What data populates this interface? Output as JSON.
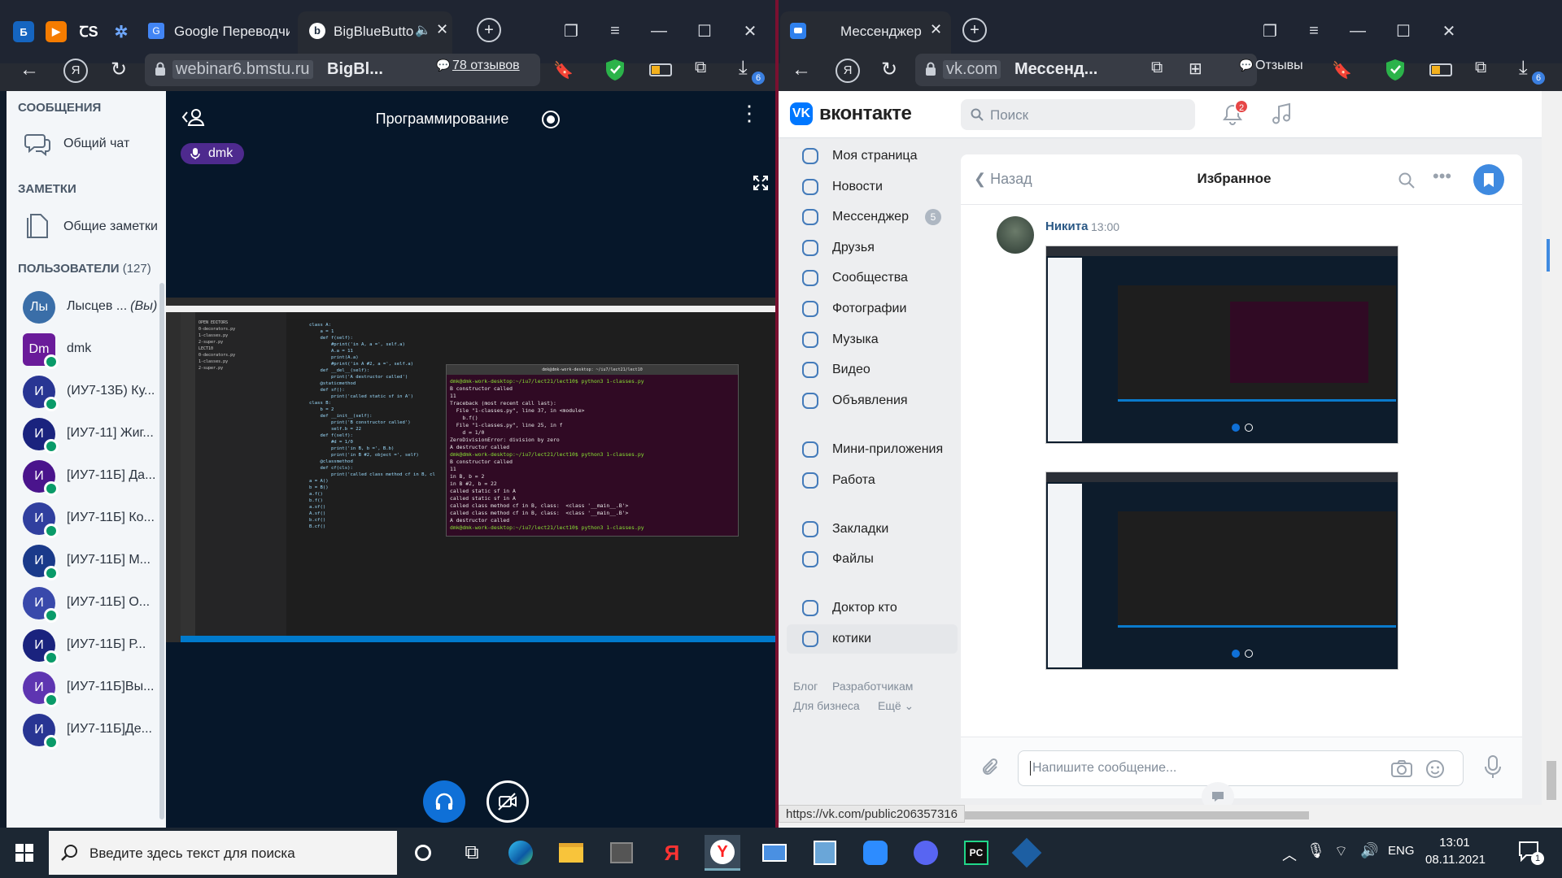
{
  "left_browser": {
    "tabs": [
      {
        "label": "Google Переводчи"
      },
      {
        "label": "BigBlueButton"
      }
    ],
    "address": {
      "domain": "webinar6.bmstu.ru",
      "title": "BigBl..."
    },
    "reviews": "78 отзывов",
    "downloads_badge": "6"
  },
  "bbb": {
    "sections": {
      "messages": "СООБЩЕНИЯ",
      "notes": "ЗАМЕТКИ",
      "users": "ПОЛЬЗОВАТЕЛИ",
      "users_count": "(127)"
    },
    "public_chat": "Общий чат",
    "shared_notes": "Общие заметки",
    "users": [
      {
        "initials": "Лы",
        "name": "Лысцев ...",
        "suffix": "(Вы)",
        "color": "#3a6ea8"
      },
      {
        "initials": "Dm",
        "name": "dmk",
        "color": "#6a1b9a"
      },
      {
        "initials": "И",
        "name": "(ИУ7-13Б) Ку...",
        "color": "#283593"
      },
      {
        "initials": "И",
        "name": "[ИУ7-11] Жиг...",
        "color": "#1a237e"
      },
      {
        "initials": "И",
        "name": "[ИУ7-11Б] Да...",
        "color": "#4a148c"
      },
      {
        "initials": "И",
        "name": "[ИУ7-11Б] Ко...",
        "color": "#303f9f"
      },
      {
        "initials": "И",
        "name": "[ИУ7-11Б] М...",
        "color": "#1a3a8a"
      },
      {
        "initials": "И",
        "name": "[ИУ7-11Б] О...",
        "color": "#3949ab"
      },
      {
        "initials": "И",
        "name": "[ИУ7-11Б] Р...",
        "color": "#1a237e"
      },
      {
        "initials": "И",
        "name": "[ИУ7-11Б]Вы...",
        "color": "#5e35b1"
      },
      {
        "initials": "И",
        "name": "[ИУ7-11Б]Де...",
        "color": "#283593"
      }
    ],
    "meeting_title": "Программирование",
    "presenter": "dmk",
    "terminal": {
      "title": "dmk@dmk-work-desktop: ~/iu7/lect21/lect10",
      "lines": [
        "dmk@dmk-work-desktop:~/iu7/lect21/lect10$ python3 1-classes.py",
        "B constructor called",
        "11",
        "Traceback (most recent call last):",
        "  File \"1-classes.py\", line 37, in <module>",
        "    b.f()",
        "  File \"1-classes.py\", line 25, in f",
        "    d = 1/0",
        "ZeroDivisionError: division by zero",
        "A destructor called",
        "dmk@dmk-work-desktop:~/iu7/lect21/lect10$ python3 1-classes.py",
        "B constructor called",
        "11",
        "in B, b = 2",
        "in B #2, b = 22",
        "called static sf in A",
        "called static sf in A",
        "called class method cf in B, class:  <class '__main__.B'>",
        "called class method cf in B, class:  <class '__main__.B'>",
        "A destructor called",
        "dmk@dmk-work-desktop:~/iu7/lect21/lect10$ python3 1-classes.py"
      ]
    },
    "code_lines": [
      "class A:",
      "    a = 1",
      "",
      "    def f(self):",
      "        #print('in A, a =', self.a)",
      "        A.a = 11",
      "        print(A.a)",
      "        #print('in A #2, a =', self.a)",
      "",
      "    def __del__(self):",
      "        print('A destructor called')",
      "",
      "    @staticmethod",
      "    def sf():",
      "        print('called static sf in A')",
      "",
      "class B:",
      "    b = 2",
      "",
      "    def __init__(self):",
      "        print('B constructor called')",
      "        self.b = 22",
      "",
      "    def f(self):",
      "        #d = 1/0",
      "        print('in B, b =', B.b)",
      "        print('in B #2, object =', self)",
      "",
      "    @classmethod",
      "    def cf(cls):",
      "        print('called class method cf in B, cl",
      "",
      "a = A()",
      "b = B()",
      "",
      "a.f()",
      "b.f()",
      "",
      "a.sf()",
      "A.sf()",
      "",
      "b.cf()",
      "B.cf()"
    ],
    "explorer": [
      "OPEN EDITORS",
      "0-decorators.py",
      "1-classes.py",
      "2-super.py",
      "LECT10",
      "0-decorators.py",
      "1-classes.py",
      "2-super.py"
    ]
  },
  "right_browser": {
    "tab": "Мессенджер",
    "address": {
      "domain": "vk.com",
      "title": "Мессенд..."
    },
    "reviews": "Отзывы",
    "downloads_badge": "6",
    "status_url": "https://vk.com/public206357316"
  },
  "vk": {
    "logo": "вконтакте",
    "search_placeholder": "Поиск",
    "notif_badge": "2",
    "menu": [
      {
        "label": "Моя страница",
        "icon": "user-circle-icon"
      },
      {
        "label": "Новости",
        "icon": "news-icon"
      },
      {
        "label": "Мессенджер",
        "icon": "message-icon",
        "badge": "5"
      },
      {
        "label": "Друзья",
        "icon": "friends-icon"
      },
      {
        "label": "Сообщества",
        "icon": "communities-icon"
      },
      {
        "label": "Фотографии",
        "icon": "photo-icon"
      },
      {
        "label": "Музыка",
        "icon": "music-icon"
      },
      {
        "label": "Видео",
        "icon": "video-icon"
      },
      {
        "label": "Объявления",
        "icon": "ads-icon"
      },
      {
        "label": "Мини-приложения",
        "icon": "apps-icon"
      },
      {
        "label": "Работа",
        "icon": "work-icon"
      },
      {
        "label": "Закладки",
        "icon": "star-icon"
      },
      {
        "label": "Файлы",
        "icon": "files-icon"
      },
      {
        "label": "Доктор кто",
        "icon": "group-icon"
      },
      {
        "label": "котики",
        "icon": "group-icon"
      }
    ],
    "footer": {
      "blog": "Блог",
      "dev": "Разработчикам",
      "biz": "Для бизнеса",
      "more": "Ещё"
    },
    "chat": {
      "back": "Назад",
      "title": "Избранное",
      "author": "Никита",
      "time": "13:00",
      "input_placeholder": "Напишите сообщение..."
    }
  },
  "taskbar": {
    "search_placeholder": "Введите здесь текст для поиска",
    "lang": "ENG",
    "time": "13:01",
    "date": "08.11.2021",
    "notif_count": "1"
  }
}
